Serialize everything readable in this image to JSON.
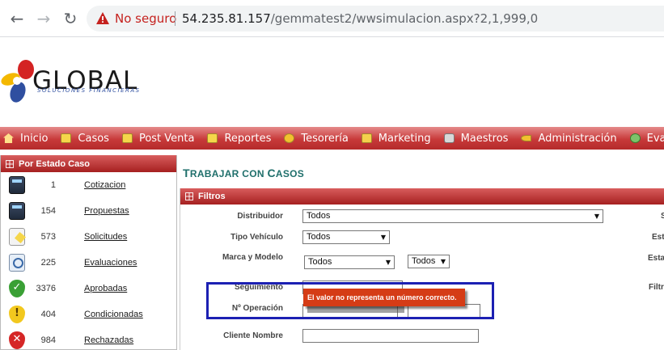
{
  "browser": {
    "back": "←",
    "forward": "→",
    "reload": "↻",
    "security_label": "No seguro",
    "url_host": "54.235.81.157",
    "url_path": "/gemmatest2/wwsimulacion.aspx?2,1,999,0"
  },
  "logo": {
    "name": "GLOBAL",
    "tagline": "SOLUCIONES FINANCIERAS"
  },
  "menu": [
    {
      "label": "Inicio",
      "icon": "home-icon"
    },
    {
      "label": "Casos",
      "icon": "folder-icon"
    },
    {
      "label": "Post Venta",
      "icon": "folder-icon"
    },
    {
      "label": "Reportes",
      "icon": "folder-icon"
    },
    {
      "label": "Tesorería",
      "icon": "coin-icon"
    },
    {
      "label": "Marketing",
      "icon": "screen-icon"
    },
    {
      "label": "Maestros",
      "icon": "database-icon"
    },
    {
      "label": "Administración",
      "icon": "key-icon"
    },
    {
      "label": "Evalua",
      "icon": "evaluation-icon"
    }
  ],
  "sidebar": {
    "title": "Por Estado Caso",
    "items": [
      {
        "count": "1",
        "label": "Cotizacion",
        "icon": "calculator-icon"
      },
      {
        "count": "154",
        "label": "Propuestas",
        "icon": "calculator-icon"
      },
      {
        "count": "573",
        "label": "Solicitudes",
        "icon": "document-edit-icon"
      },
      {
        "count": "225",
        "label": "Evaluaciones",
        "icon": "magnifier-icon"
      },
      {
        "count": "3376",
        "label": "Aprobadas",
        "icon": "shield-check-icon"
      },
      {
        "count": "404",
        "label": "Condicionadas",
        "icon": "shield-warning-icon"
      },
      {
        "count": "984",
        "label": "Rechazadas",
        "icon": "shield-x-icon"
      }
    ]
  },
  "main": {
    "title_first": "T",
    "title_rest1": "RABAJAR CON ",
    "title_cap2": "C",
    "title_rest2": "ASOS",
    "filters": {
      "title": "Filtros",
      "distribuidor_label": "Distribuidor",
      "distribuidor_value": "Todos",
      "tipo_vehiculo_label": "Tipo Vehículo",
      "tipo_vehiculo_value": "Todos",
      "marca_modelo_label": "Marca y Modelo",
      "marca_value": "Todos",
      "modelo_value": "Todos",
      "seguimiento_label": "Seguimiento",
      "operacion_label": "Nº Operación",
      "cliente_label": "Cliente Nombre",
      "right_labels": [
        "S",
        "Esta",
        "Esta",
        "Filtr"
      ]
    },
    "tooltip": "El valor no representa un número correcto."
  },
  "colors": {
    "menu_red": "#c83a3a",
    "title_teal": "#1f6f6b",
    "tooltip_red": "#d53c16",
    "highlight_blue": "#1c20b3",
    "not_secure_red": "#c5221f"
  }
}
